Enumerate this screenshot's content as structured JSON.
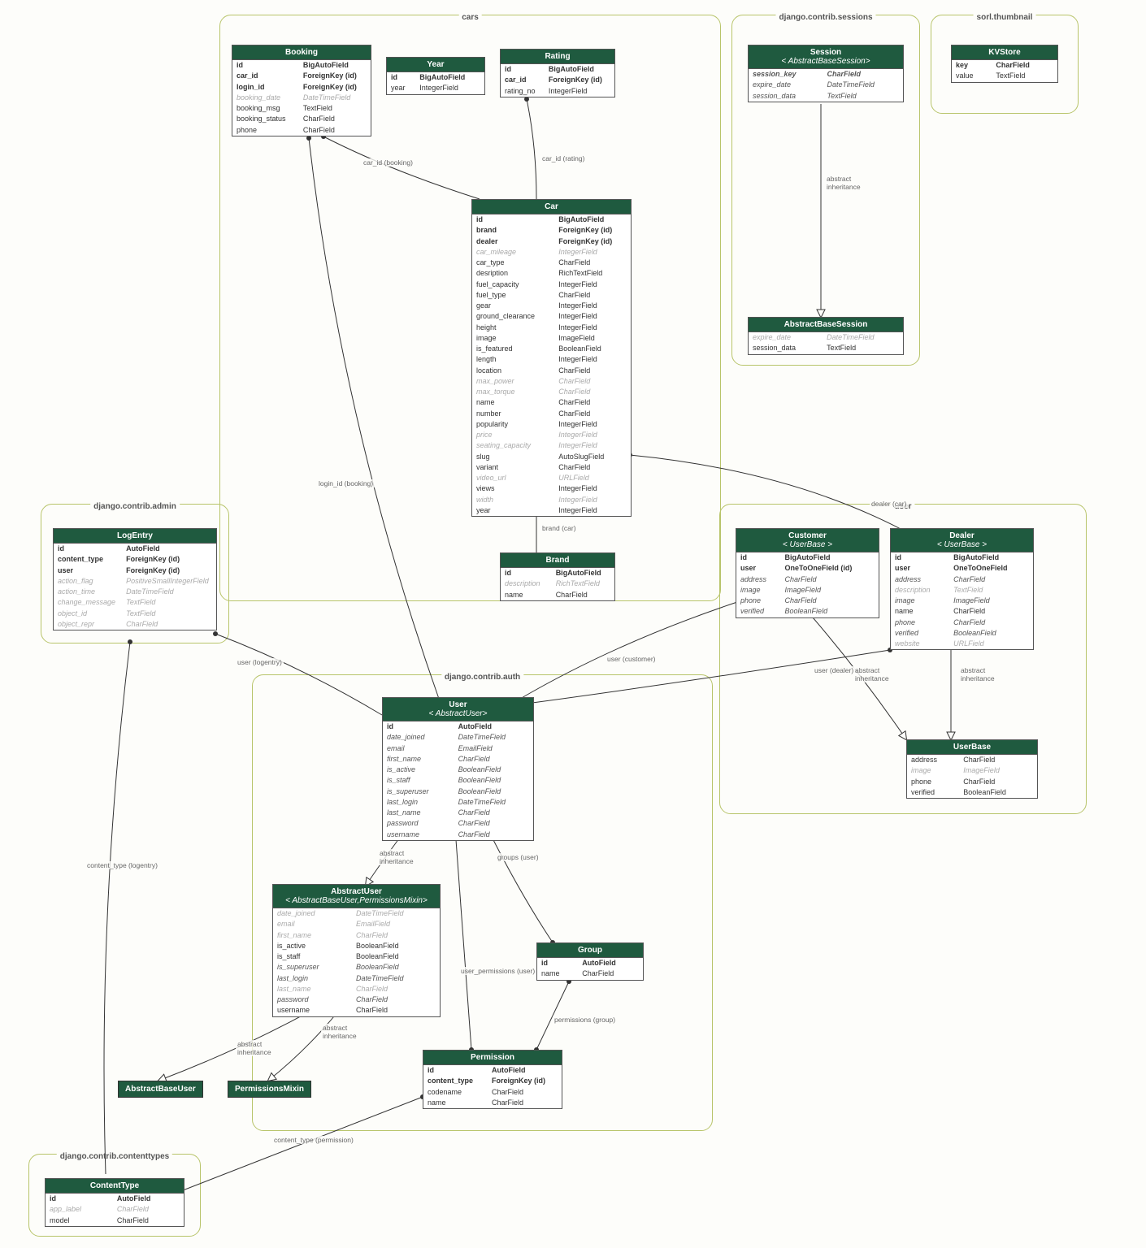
{
  "apps": {
    "cars": "cars",
    "sessions": "django.contrib.sessions",
    "thumb": "sorl.thumbnail",
    "admin": "django.contrib.admin",
    "user": "user",
    "auth": "django.contrib.auth",
    "ct": "django.contrib.contenttypes"
  },
  "entities": {
    "booking": {
      "title": "Booking",
      "fields": [
        [
          "id",
          "BigAutoField",
          "bold"
        ],
        [
          "car_id",
          "ForeignKey (id)",
          "bold"
        ],
        [
          "login_id",
          "ForeignKey (id)",
          "bold"
        ],
        [
          "booking_date",
          "DateTimeField",
          "faded"
        ],
        [
          "booking_msg",
          "TextField",
          ""
        ],
        [
          "booking_status",
          "CharField",
          ""
        ],
        [
          "phone",
          "CharField",
          ""
        ]
      ]
    },
    "year": {
      "title": "Year",
      "fields": [
        [
          "id",
          "BigAutoField",
          "bold"
        ],
        [
          "year",
          "IntegerField",
          ""
        ]
      ]
    },
    "rating": {
      "title": "Rating",
      "fields": [
        [
          "id",
          "BigAutoField",
          "bold"
        ],
        [
          "car_id",
          "ForeignKey (id)",
          "bold"
        ],
        [
          "rating_no",
          "IntegerField",
          ""
        ]
      ]
    },
    "car": {
      "title": "Car",
      "fields": [
        [
          "id",
          "BigAutoField",
          "bold"
        ],
        [
          "brand",
          "ForeignKey (id)",
          "bold"
        ],
        [
          "dealer",
          "ForeignKey (id)",
          "bold"
        ],
        [
          "car_mileage",
          "IntegerField",
          "faded"
        ],
        [
          "car_type",
          "CharField",
          ""
        ],
        [
          "desription",
          "RichTextField",
          ""
        ],
        [
          "fuel_capacity",
          "IntegerField",
          ""
        ],
        [
          "fuel_type",
          "CharField",
          ""
        ],
        [
          "gear",
          "IntegerField",
          ""
        ],
        [
          "ground_clearance",
          "IntegerField",
          ""
        ],
        [
          "height",
          "IntegerField",
          ""
        ],
        [
          "image",
          "ImageField",
          ""
        ],
        [
          "is_featured",
          "BooleanField",
          ""
        ],
        [
          "length",
          "IntegerField",
          ""
        ],
        [
          "location",
          "CharField",
          ""
        ],
        [
          "max_power",
          "CharField",
          "faded"
        ],
        [
          "max_torque",
          "CharField",
          "faded"
        ],
        [
          "name",
          "CharField",
          ""
        ],
        [
          "number",
          "CharField",
          ""
        ],
        [
          "popularity",
          "IntegerField",
          ""
        ],
        [
          "price",
          "IntegerField",
          "faded"
        ],
        [
          "seating_capacity",
          "IntegerField",
          "faded"
        ],
        [
          "slug",
          "AutoSlugField",
          ""
        ],
        [
          "variant",
          "CharField",
          ""
        ],
        [
          "video_url",
          "URLField",
          "faded"
        ],
        [
          "views",
          "IntegerField",
          ""
        ],
        [
          "width",
          "IntegerField",
          "faded"
        ],
        [
          "year",
          "IntegerField",
          ""
        ]
      ]
    },
    "brand": {
      "title": "Brand",
      "fields": [
        [
          "id",
          "BigAutoField",
          "bold"
        ],
        [
          "description",
          "RichTextField",
          "faded"
        ],
        [
          "name",
          "CharField",
          ""
        ]
      ]
    },
    "session": {
      "title": "Session",
      "subtitle": "< AbstractBaseSession>",
      "fields": [
        [
          "session_key",
          "CharField",
          "bold italic"
        ],
        [
          "expire_date",
          "DateTimeField",
          "italic"
        ],
        [
          "session_data",
          "TextField",
          "italic"
        ]
      ]
    },
    "abs_session": {
      "title": "AbstractBaseSession",
      "fields": [
        [
          "expire_date",
          "DateTimeField",
          "faded"
        ],
        [
          "session_data",
          "TextField",
          ""
        ]
      ]
    },
    "kvstore": {
      "title": "KVStore",
      "fields": [
        [
          "key",
          "CharField",
          "bold"
        ],
        [
          "value",
          "TextField",
          ""
        ]
      ]
    },
    "logentry": {
      "title": "LogEntry",
      "fields": [
        [
          "id",
          "AutoField",
          "bold"
        ],
        [
          "content_type",
          "ForeignKey (id)",
          "bold"
        ],
        [
          "user",
          "ForeignKey (id)",
          "bold"
        ],
        [
          "action_flag",
          "PositiveSmallIntegerField",
          "faded"
        ],
        [
          "action_time",
          "DateTimeField",
          "faded"
        ],
        [
          "change_message",
          "TextField",
          "faded"
        ],
        [
          "object_id",
          "TextField",
          "faded"
        ],
        [
          "object_repr",
          "CharField",
          "faded"
        ]
      ]
    },
    "customer": {
      "title": "Customer",
      "subtitle": "< UserBase >",
      "fields": [
        [
          "id",
          "BigAutoField",
          "bold"
        ],
        [
          "user",
          "OneToOneField (id)",
          "bold"
        ],
        [
          "address",
          "CharField",
          "italic"
        ],
        [
          "image",
          "ImageField",
          "italic"
        ],
        [
          "phone",
          "CharField",
          "italic"
        ],
        [
          "verified",
          "BooleanField",
          "italic"
        ]
      ]
    },
    "dealer": {
      "title": "Dealer",
      "subtitle": "< UserBase >",
      "fields": [
        [
          "id",
          "BigAutoField",
          "bold"
        ],
        [
          "user",
          "OneToOneField",
          "bold"
        ],
        [
          "address",
          "CharField",
          "italic"
        ],
        [
          "description",
          "TextField",
          "faded"
        ],
        [
          "image",
          "ImageField",
          "italic"
        ],
        [
          "name",
          "CharField",
          ""
        ],
        [
          "phone",
          "CharField",
          "italic"
        ],
        [
          "verified",
          "BooleanField",
          "italic"
        ],
        [
          "website",
          "URLField",
          "faded"
        ]
      ]
    },
    "userbase": {
      "title": "UserBase",
      "fields": [
        [
          "address",
          "CharField",
          ""
        ],
        [
          "image",
          "ImageField",
          "faded"
        ],
        [
          "phone",
          "CharField",
          ""
        ],
        [
          "verified",
          "BooleanField",
          ""
        ]
      ]
    },
    "user": {
      "title": "User",
      "subtitle": "< AbstractUser>",
      "fields": [
        [
          "id",
          "AutoField",
          "bold"
        ],
        [
          "date_joined",
          "DateTimeField",
          "italic"
        ],
        [
          "email",
          "EmailField",
          "italic"
        ],
        [
          "first_name",
          "CharField",
          "italic"
        ],
        [
          "is_active",
          "BooleanField",
          "italic"
        ],
        [
          "is_staff",
          "BooleanField",
          "italic"
        ],
        [
          "is_superuser",
          "BooleanField",
          "italic"
        ],
        [
          "last_login",
          "DateTimeField",
          "italic"
        ],
        [
          "last_name",
          "CharField",
          "italic"
        ],
        [
          "password",
          "CharField",
          "italic"
        ],
        [
          "username",
          "CharField",
          "italic"
        ]
      ]
    },
    "abstractuser": {
      "title": "AbstractUser",
      "subtitle": "< AbstractBaseUser,PermissionsMixin>",
      "fields": [
        [
          "date_joined",
          "DateTimeField",
          "faded"
        ],
        [
          "email",
          "EmailField",
          "faded"
        ],
        [
          "first_name",
          "CharField",
          "faded"
        ],
        [
          "is_active",
          "BooleanField",
          ""
        ],
        [
          "is_staff",
          "BooleanField",
          ""
        ],
        [
          "is_superuser",
          "BooleanField",
          "italic"
        ],
        [
          "last_login",
          "DateTimeField",
          "italic faded"
        ],
        [
          "last_name",
          "CharField",
          "faded"
        ],
        [
          "password",
          "CharField",
          "italic"
        ],
        [
          "username",
          "CharField",
          ""
        ]
      ]
    },
    "group": {
      "title": "Group",
      "fields": [
        [
          "id",
          "AutoField",
          "bold"
        ],
        [
          "name",
          "CharField",
          ""
        ]
      ]
    },
    "permission": {
      "title": "Permission",
      "fields": [
        [
          "id",
          "AutoField",
          "bold"
        ],
        [
          "content_type",
          "ForeignKey (id)",
          "bold"
        ],
        [
          "codename",
          "CharField",
          ""
        ],
        [
          "name",
          "CharField",
          ""
        ]
      ]
    },
    "contenttype": {
      "title": "ContentType",
      "fields": [
        [
          "id",
          "AutoField",
          "bold"
        ],
        [
          "app_label",
          "CharField",
          "faded"
        ],
        [
          "model",
          "CharField",
          ""
        ]
      ]
    }
  },
  "simpleBoxes": {
    "abu": "AbstractBaseUser",
    "pmix": "PermissionsMixin"
  },
  "edgeLabels": {
    "car_booking": "car_id (booking)",
    "car_rating": "car_id (rating)",
    "login_booking": "login_id (booking)",
    "brand_car": "brand (car)",
    "dealer_car": "dealer (car)",
    "abs_inh1": "abstract\ninheritance",
    "abs_inh2": "abstract\ninheritance",
    "abs_inh3": "abstract\ninheritance",
    "abs_inh4": "abstract\ninheritance",
    "abs_inh5": "abstract\ninheritance",
    "abs_inh6": "abstract\ninheritance",
    "user_logentry": "user (logentry)",
    "user_customer": "user (customer)",
    "user_dealer": "user (dealer)",
    "groups_user": "groups (user)",
    "userperm_user": "user_permissions (user)",
    "perm_group": "permissions (group)",
    "ct_logentry": "content_type (logentry)",
    "ct_perm": "content_type (permission)"
  }
}
